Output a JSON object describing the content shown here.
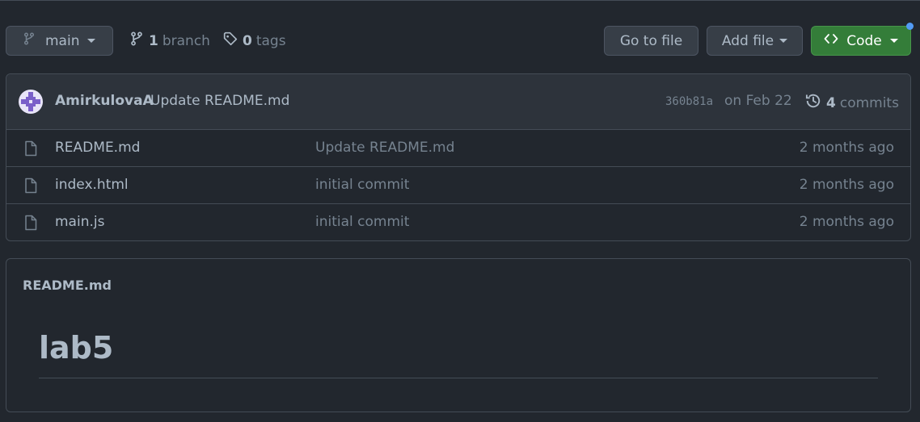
{
  "toolbar": {
    "branch_name": "main",
    "branch_count": "1",
    "branch_label": "branch",
    "tag_count": "0",
    "tag_label": "tags",
    "goto_label": "Go to file",
    "addfile_label": "Add file",
    "code_label": "Code"
  },
  "latest_commit": {
    "author": "AmirkulovaA",
    "message": "Update README.md",
    "sha": "360b81a",
    "date": "on Feb 22",
    "commit_count": "4",
    "commit_label": "commits"
  },
  "files": [
    {
      "name": "README.md",
      "commit": "Update README.md",
      "age": "2 months ago"
    },
    {
      "name": "index.html",
      "commit": "initial commit",
      "age": "2 months ago"
    },
    {
      "name": "main.js",
      "commit": "initial commit",
      "age": "2 months ago"
    }
  ],
  "readme": {
    "title": "README.md",
    "heading": "lab5"
  },
  "colors": {
    "background": "#22272e",
    "code_button": "#347d39",
    "notification_dot": "#539bf5"
  },
  "icons": {
    "branch": "git-branch-icon",
    "tag": "tag-icon",
    "code": "code-icon",
    "history": "history-icon",
    "file": "file-icon"
  }
}
